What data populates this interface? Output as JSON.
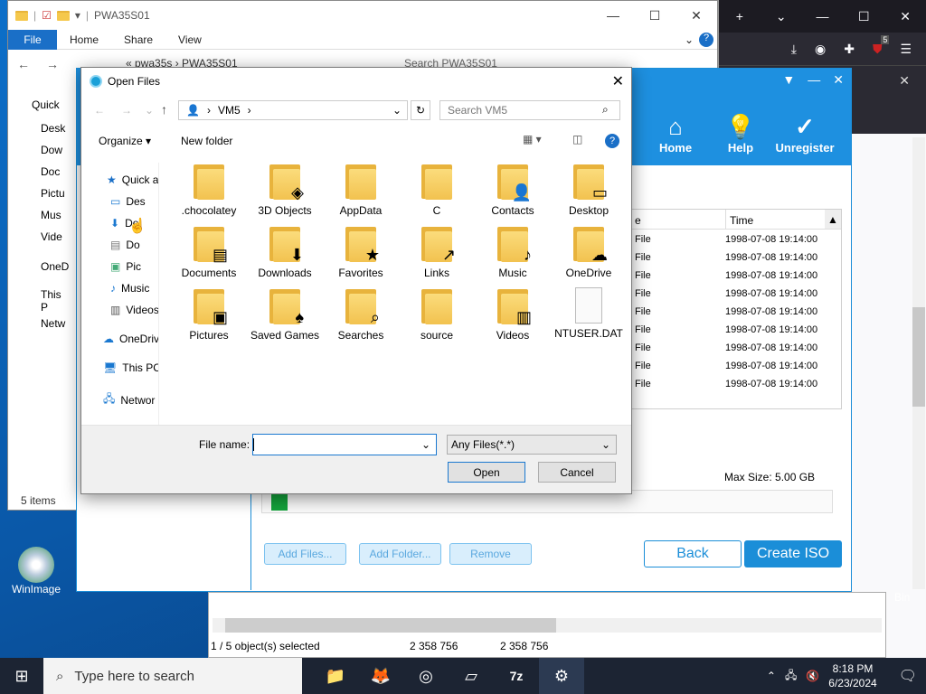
{
  "explorer": {
    "title": "PWA35S01",
    "ribbon": [
      "File",
      "Home",
      "Share",
      "View"
    ],
    "breadcrumb": "« pwa35s › PWA35S01",
    "search": "Search PWA35S01",
    "nav": [
      "Quick",
      "Desk",
      "Dow",
      "Doc",
      "Pictu",
      "Mus",
      "Vide",
      "OneD",
      "This P",
      "Netw"
    ],
    "status": "5 items"
  },
  "app": {
    "nav": [
      {
        "label": "Home",
        "glyph": "⌂"
      },
      {
        "label": "Help",
        "glyph": "💡"
      },
      {
        "label": "Unregister",
        "glyph": "✓"
      }
    ],
    "table": {
      "headers": [
        "e",
        "Time"
      ],
      "rows": [
        [
          "File",
          "1998-07-08 19:14:00"
        ],
        [
          "File",
          "1998-07-08 19:14:00"
        ],
        [
          "File",
          "1998-07-08 19:14:00"
        ],
        [
          "File",
          "1998-07-08 19:14:00"
        ],
        [
          "File",
          "1998-07-08 19:14:00"
        ],
        [
          "File",
          "1998-07-08 19:14:00"
        ],
        [
          "File",
          "1998-07-08 19:14:00"
        ],
        [
          "File",
          "1998-07-08 19:14:00"
        ],
        [
          "File",
          "1998-07-08 19:14:00"
        ]
      ]
    },
    "max_size": "Max Size: 5.00 GB",
    "buttons": {
      "add_files": "Add Files...",
      "add_folder": "Add Folder...",
      "remove": "Remove",
      "back": "Back",
      "create": "Create ISO"
    }
  },
  "dialog": {
    "title": "Open Files",
    "path": "VM5",
    "search_placeholder": "Search VM5",
    "organize": "Organize ▾",
    "new_folder": "New folder",
    "sidebar": [
      "Quick a",
      "Des",
      "Do",
      "Do",
      "Pic",
      "Music",
      "Videos",
      "OneDriv",
      "This PC",
      "Networ"
    ],
    "items": [
      ".chocolatey",
      "3D Objects",
      "AppData",
      "C",
      "Contacts",
      "Desktop",
      "Documents",
      "Downloads",
      "Favorites",
      "Links",
      "Music",
      "OneDrive",
      "Pictures",
      "Saved Games",
      "Searches",
      "source",
      "Videos",
      "NTUSER.DAT"
    ],
    "filename_label": "File name:",
    "filename_value": "",
    "filter": "Any Files(*.*)",
    "open": "Open",
    "cancel": "Cancel"
  },
  "status": {
    "selected": "1 / 5 object(s) selected",
    "size1": "2 358 756",
    "size2": "2 358 756",
    "recycle": "Bin"
  },
  "desktop": {
    "icon_label": "WinImage"
  },
  "taskbar": {
    "search": "Type here to search",
    "time": "8:18 PM",
    "date": "6/23/2024",
    "apps": [
      "📁",
      "🦊",
      "◎",
      "▱",
      "7z",
      "⚙"
    ]
  },
  "firefox": {
    "badge": "5"
  }
}
